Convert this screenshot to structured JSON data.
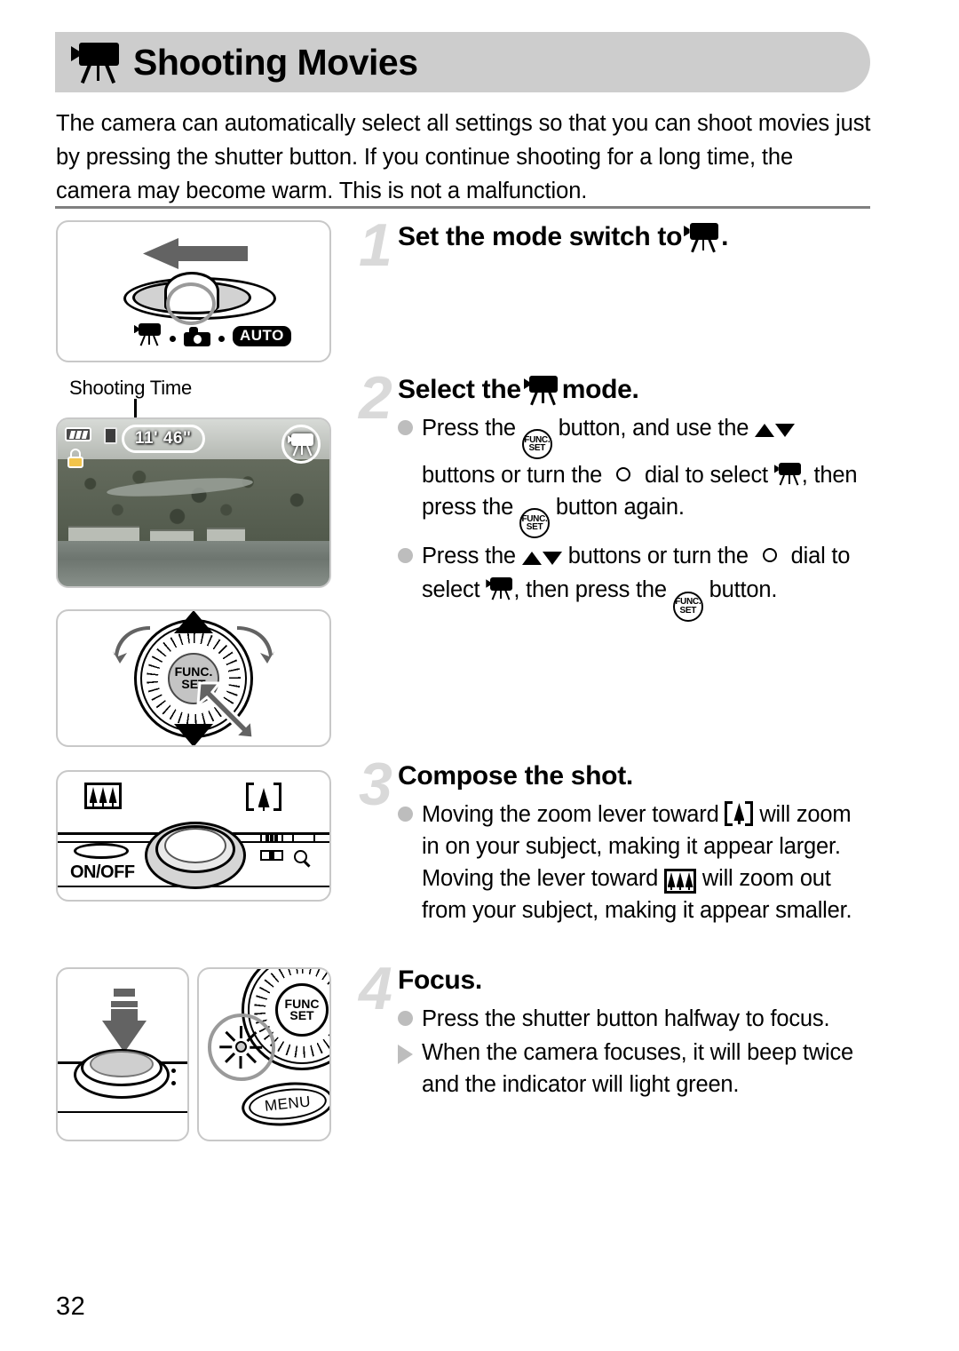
{
  "page": {
    "number": "32",
    "title": "Shooting Movies",
    "title_icon": "movie-mode-icon",
    "intro": "The camera can automatically select all settings so that you can shoot movies just by pressing the shutter button. If you continue shooting for a long time, the camera may become warm. This is not a malfunction."
  },
  "figures": {
    "mode_switch": {
      "name": "mode-switch-illustration",
      "arrow": "left-arrow",
      "labels": [
        "movie-mode-icon",
        "still-camera-icon",
        "AUTO"
      ]
    },
    "lcd": {
      "name": "lcd-screen-illustration",
      "callout_label": "Shooting Time",
      "shooting_time": "11' 46\"",
      "icons": [
        "battery-icon",
        "lock-icon",
        "memory-card-icon",
        "movie-mode-icon"
      ]
    },
    "control_dial": {
      "name": "control-dial-illustration",
      "center_label_line1": "FUNC.",
      "center_label_line2": "SET"
    },
    "zoom_lever": {
      "name": "zoom-lever-illustration",
      "power_label": "ON/OFF",
      "wide_icon": "wide-angle-icon",
      "tele_icon": "telephoto-icon"
    },
    "shutter": {
      "name": "shutter-button-illustration"
    },
    "menu": {
      "name": "menu-and-indicator-illustration",
      "func_label_line1": "FUNC",
      "func_label_line2": "SET",
      "menu_label": "MENU"
    }
  },
  "steps": [
    {
      "number": "1",
      "heading_pre": "Set the mode switch to ",
      "heading_icon": "movie-mode-icon",
      "heading_post": ".",
      "bullets": []
    },
    {
      "number": "2",
      "heading_pre": "Select the ",
      "heading_icon": "movie-mode-icon",
      "heading_post": " mode.",
      "bullets": [
        {
          "marker": "dot",
          "parts": [
            {
              "t": "text",
              "v": "Press the "
            },
            {
              "t": "icon",
              "v": "func-set-icon"
            },
            {
              "t": "text",
              "v": " button, and use the "
            },
            {
              "t": "icon",
              "v": "up-down-buttons-icon"
            },
            {
              "t": "text",
              "v": " buttons or turn the "
            },
            {
              "t": "icon",
              "v": "control-dial-icon"
            },
            {
              "t": "text",
              "v": " dial to select "
            },
            {
              "t": "icon",
              "v": "movie-mode-icon"
            },
            {
              "t": "text",
              "v": ", then press the "
            },
            {
              "t": "icon",
              "v": "func-set-icon"
            },
            {
              "t": "text",
              "v": " button again."
            }
          ]
        },
        {
          "marker": "dot",
          "parts": [
            {
              "t": "text",
              "v": "Press the "
            },
            {
              "t": "icon",
              "v": "up-down-buttons-icon"
            },
            {
              "t": "text",
              "v": " buttons or turn the "
            },
            {
              "t": "icon",
              "v": "control-dial-icon"
            },
            {
              "t": "text",
              "v": " dial to select "
            },
            {
              "t": "icon",
              "v": "movie-mode-icon"
            },
            {
              "t": "text",
              "v": ", then press the "
            },
            {
              "t": "icon",
              "v": "func-set-icon"
            },
            {
              "t": "text",
              "v": " button."
            }
          ]
        }
      ]
    },
    {
      "number": "3",
      "heading_pre": "Compose the shot.",
      "heading_icon": null,
      "heading_post": "",
      "bullets": [
        {
          "marker": "dot",
          "parts": [
            {
              "t": "text",
              "v": "Moving the zoom lever toward "
            },
            {
              "t": "icon",
              "v": "telephoto-icon"
            },
            {
              "t": "text",
              "v": " will zoom in on your subject, making it appear larger. Moving the lever toward "
            },
            {
              "t": "icon",
              "v": "wide-angle-icon"
            },
            {
              "t": "text",
              "v": " will zoom out from your subject, making it appear smaller."
            }
          ]
        }
      ]
    },
    {
      "number": "4",
      "heading_pre": "Focus.",
      "heading_icon": null,
      "heading_post": "",
      "bullets": [
        {
          "marker": "dot",
          "parts": [
            {
              "t": "text",
              "v": "Press the shutter button halfway to focus."
            }
          ]
        },
        {
          "marker": "triangle",
          "parts": [
            {
              "t": "text",
              "v": "When the camera focuses, it will beep twice and the indicator will light green."
            }
          ]
        }
      ]
    }
  ],
  "colors": {
    "title_bar_bg": "#cdcdcd",
    "step_number": "#d9d9d9",
    "bullet": "#bdbdbd",
    "divider": "#808080",
    "figure_border": "#c8c8c8",
    "arrow_gray": "#636363"
  }
}
